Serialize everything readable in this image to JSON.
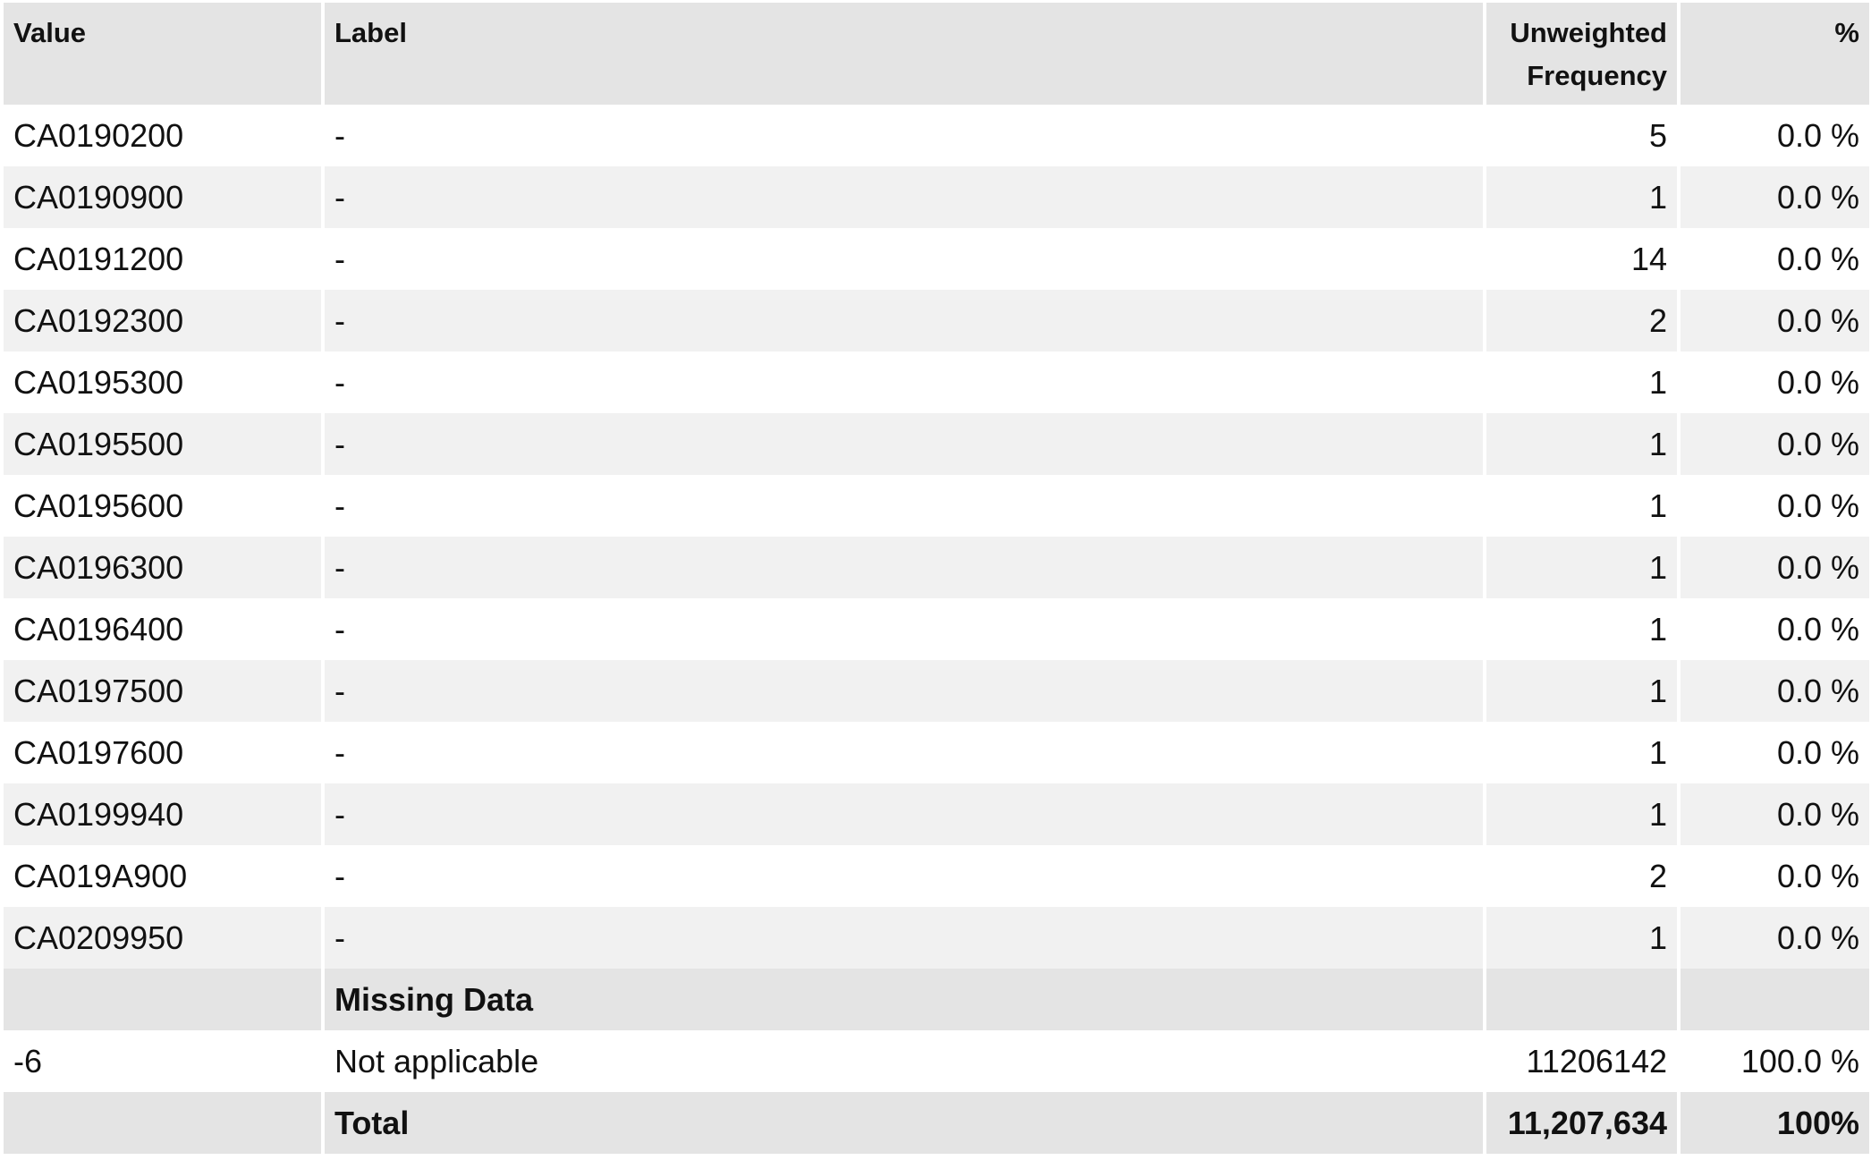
{
  "table": {
    "headers": {
      "value": "Value",
      "label": "Label",
      "frequency": "Unweighted Frequency",
      "percent": "%"
    },
    "rows": [
      {
        "value": "CA0190200",
        "label": "-",
        "frequency": "5",
        "percent": "0.0 %"
      },
      {
        "value": "CA0190900",
        "label": "-",
        "frequency": "1",
        "percent": "0.0 %"
      },
      {
        "value": "CA0191200",
        "label": "-",
        "frequency": "14",
        "percent": "0.0 %"
      },
      {
        "value": "CA0192300",
        "label": "-",
        "frequency": "2",
        "percent": "0.0 %"
      },
      {
        "value": "CA0195300",
        "label": "-",
        "frequency": "1",
        "percent": "0.0 %"
      },
      {
        "value": "CA0195500",
        "label": "-",
        "frequency": "1",
        "percent": "0.0 %"
      },
      {
        "value": "CA0195600",
        "label": "-",
        "frequency": "1",
        "percent": "0.0 %"
      },
      {
        "value": "CA0196300",
        "label": "-",
        "frequency": "1",
        "percent": "0.0 %"
      },
      {
        "value": "CA0196400",
        "label": "-",
        "frequency": "1",
        "percent": "0.0 %"
      },
      {
        "value": "CA0197500",
        "label": "-",
        "frequency": "1",
        "percent": "0.0 %"
      },
      {
        "value": "CA0197600",
        "label": "-",
        "frequency": "1",
        "percent": "0.0 %"
      },
      {
        "value": "CA0199940",
        "label": "-",
        "frequency": "1",
        "percent": "0.0 %"
      },
      {
        "value": "CA019A900",
        "label": "-",
        "frequency": "2",
        "percent": "0.0 %"
      },
      {
        "value": "CA0209950",
        "label": "-",
        "frequency": "1",
        "percent": "0.0 %"
      }
    ],
    "missing_section": {
      "title": "Missing Data",
      "rows": [
        {
          "value": "-6",
          "label": "Not applicable",
          "frequency": "11206142",
          "percent": "100.0 %"
        }
      ]
    },
    "total": {
      "label": "Total",
      "frequency": "11,207,634",
      "percent": "100%"
    }
  }
}
